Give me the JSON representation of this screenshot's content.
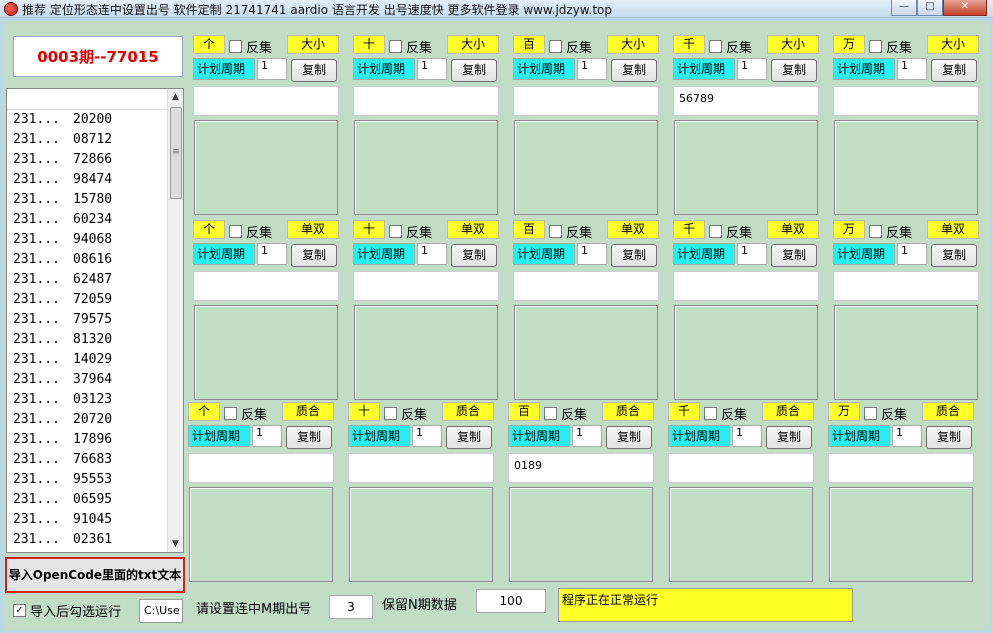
{
  "window": {
    "title": "推荐 定位形态连中设置出号 软件定制 21741741 aardio 语言开发 出号速度快 更多软件登录 www.jdzyw.top",
    "minimize": "—",
    "maximize": "□",
    "close": "✕"
  },
  "period": {
    "label": "0003期--77015"
  },
  "list": {
    "rows": [
      {
        "c1": "231...",
        "c2": "20200"
      },
      {
        "c1": "231...",
        "c2": "08712"
      },
      {
        "c1": "231...",
        "c2": "72866"
      },
      {
        "c1": "231...",
        "c2": "98474"
      },
      {
        "c1": "231...",
        "c2": "15780"
      },
      {
        "c1": "231...",
        "c2": "60234"
      },
      {
        "c1": "231...",
        "c2": "94068"
      },
      {
        "c1": "231...",
        "c2": "08616"
      },
      {
        "c1": "231...",
        "c2": "62487"
      },
      {
        "c1": "231...",
        "c2": "72059"
      },
      {
        "c1": "231...",
        "c2": "79575"
      },
      {
        "c1": "231...",
        "c2": "81320"
      },
      {
        "c1": "231...",
        "c2": "14029"
      },
      {
        "c1": "231...",
        "c2": "37964"
      },
      {
        "c1": "231...",
        "c2": "03123"
      },
      {
        "c1": "231...",
        "c2": "20720"
      },
      {
        "c1": "231...",
        "c2": "17896"
      },
      {
        "c1": "231...",
        "c2": "76683"
      },
      {
        "c1": "231...",
        "c2": "95553"
      },
      {
        "c1": "231...",
        "c2": "06595"
      },
      {
        "c1": "231...",
        "c2": "91045"
      },
      {
        "c1": "231...",
        "c2": "02361"
      }
    ],
    "scroll_up": "▲",
    "scroll_down": "▼",
    "scroll_grip": "≡"
  },
  "import_button": "导入OpenCode里面的txt文本",
  "auto_check": {
    "label": "导入后勾选运行",
    "checked": true,
    "mark": "✓"
  },
  "path_input": "C:\\Use",
  "panel_common": {
    "fanji": "反集",
    "plan": "计划周期",
    "copy": "复制"
  },
  "rows": [
    {
      "mode": "大小",
      "panels": [
        {
          "digit": "个",
          "period": "1",
          "result": ""
        },
        {
          "digit": "十",
          "period": "1",
          "result": ""
        },
        {
          "digit": "百",
          "period": "1",
          "result": ""
        },
        {
          "digit": "千",
          "period": "1",
          "result": "56789"
        },
        {
          "digit": "万",
          "period": "1",
          "result": ""
        }
      ]
    },
    {
      "mode": "单双",
      "panels": [
        {
          "digit": "个",
          "period": "1",
          "result": ""
        },
        {
          "digit": "十",
          "period": "1",
          "result": ""
        },
        {
          "digit": "百",
          "period": "1",
          "result": ""
        },
        {
          "digit": "千",
          "period": "1",
          "result": ""
        },
        {
          "digit": "万",
          "period": "1",
          "result": ""
        }
      ]
    },
    {
      "mode": "质合",
      "panels": [
        {
          "digit": "个",
          "period": "1",
          "result": ""
        },
        {
          "digit": "十",
          "period": "1",
          "result": ""
        },
        {
          "digit": "百",
          "period": "1",
          "result": "0189"
        },
        {
          "digit": "千",
          "period": "1",
          "result": ""
        },
        {
          "digit": "万",
          "period": "1",
          "result": ""
        }
      ]
    }
  ],
  "bottom": {
    "m_label": "请设置连中M期出号",
    "m_value": "3",
    "n_label": "保留N期数据",
    "n_value": "100",
    "status": "程序正在正常运行"
  }
}
